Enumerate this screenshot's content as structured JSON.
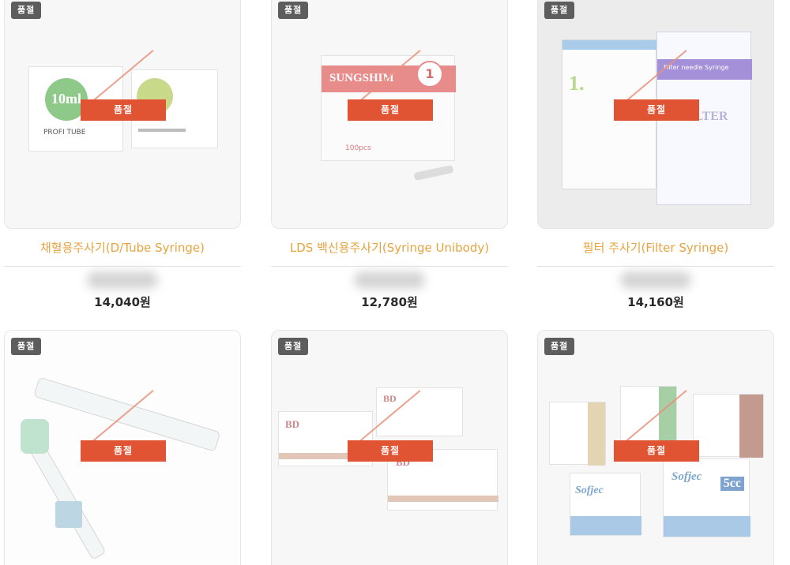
{
  "labels": {
    "badge": "품절",
    "soldout_overlay": "품절"
  },
  "products": [
    {
      "name": "채혈용주사기(D/Tube Syringe)",
      "price": "14,040원",
      "box_text": "10ml",
      "box_text2": "PROFI TUBE"
    },
    {
      "name": "LDS 백신용주사기(Syringe Unibody)",
      "price": "12,780원",
      "box_text": "SUNGSHIM",
      "box_text2": "100pcs"
    },
    {
      "name": "필터 주사기(Filter Syringe)",
      "price": "14,160원",
      "box_text": "EZ FILTER",
      "box_text2": "Filter needle Syringe"
    },
    {
      "name": "",
      "price": ""
    },
    {
      "name": "",
      "price": "",
      "box_text": "BD"
    },
    {
      "name": "",
      "price": "",
      "box_text": "Sofjec",
      "box_text2": "5cc"
    }
  ],
  "colors": {
    "soldout": "#e05333",
    "badge": "#5d5d5d",
    "name": "#e6a440"
  }
}
